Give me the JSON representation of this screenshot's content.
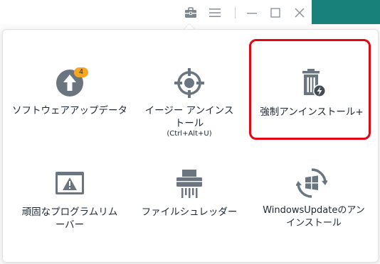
{
  "colors": {
    "icon": "#6b7580",
    "text": "#1d2733",
    "badge": "#f5a623",
    "highlight": "#e30613",
    "titlebar_icon": "#8a939c",
    "app_teal": "#18827a"
  },
  "titlebar": {
    "toolbox_icon": "toolbox-icon",
    "menu_icon": "hamburger-menu-icon",
    "minimize_icon": "minimize-icon",
    "maximize_icon": "maximize-icon",
    "close_icon": "close-icon"
  },
  "tools": [
    {
      "label": "ソフトウェアアップデータ",
      "icon": "update-arrow-icon",
      "badge": "4"
    },
    {
      "label": "イージー アンインストール",
      "sublabel": "(Ctrl+Alt+U)",
      "icon": "crosshair-icon"
    },
    {
      "label": "強制アンインストール+",
      "icon": "trash-bolt-icon"
    },
    {
      "label": "頑固なプログラムリムーバー",
      "icon": "warning-window-icon"
    },
    {
      "label": "ファイルシュレッダー",
      "icon": "shredder-icon"
    },
    {
      "label": "WindowsUpdateのアンインストール",
      "icon": "windows-update-icon"
    }
  ]
}
